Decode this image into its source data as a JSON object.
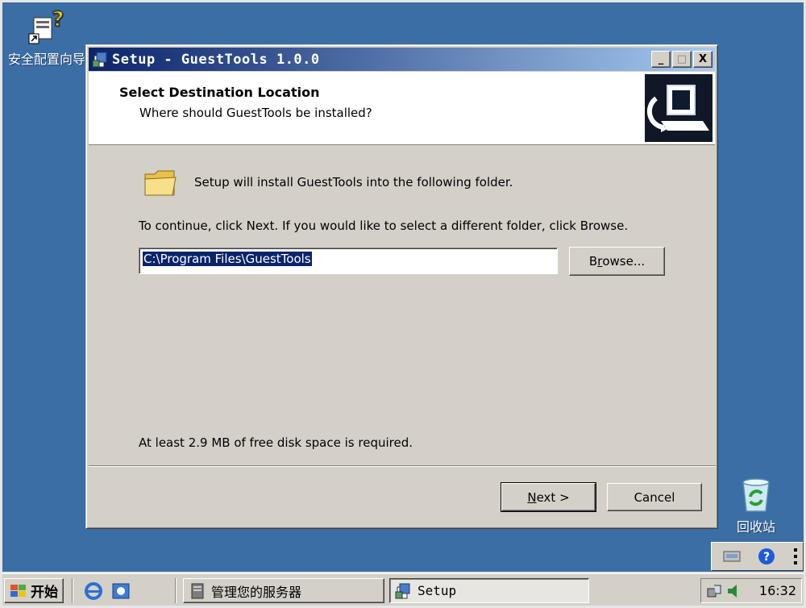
{
  "desktop": {
    "icons": [
      {
        "label": "安全配置向导",
        "icon": "security-wizard-icon"
      },
      {
        "label": "回收站",
        "icon": "recycle-bin-icon"
      }
    ]
  },
  "window": {
    "title": "Setup - GuestTools 1.0.0",
    "header_title": "Select Destination Location",
    "header_subtitle": "Where should GuestTools be installed?",
    "info_text": "Setup will install GuestTools into the following folder.",
    "instruction": "To continue, click Next. If you would like to select a different folder, click Browse.",
    "path_value": "C:\\Program Files\\GuestTools",
    "browse_prefix": "B",
    "browse_underlined": "r",
    "browse_suffix": "owse...",
    "disk_space": "At least 2.9 MB of free disk space is required.",
    "next_underlined": "N",
    "next_suffix": "ext >",
    "cancel_label": "Cancel",
    "caption_minimize": "_",
    "caption_maximize": "□",
    "caption_close": "X"
  },
  "taskbar": {
    "start_label": "开始",
    "tasks": [
      {
        "label": "管理您的服务器",
        "icon": "server-manager-icon"
      },
      {
        "label": "Setup",
        "icon": "setup-icon",
        "active": true
      }
    ],
    "clock": "16:32",
    "colors": {
      "selection": "#0a246a",
      "desktop": "#3b6ea5",
      "title_start": "#0a246a",
      "title_end": "#a6caf0"
    }
  }
}
